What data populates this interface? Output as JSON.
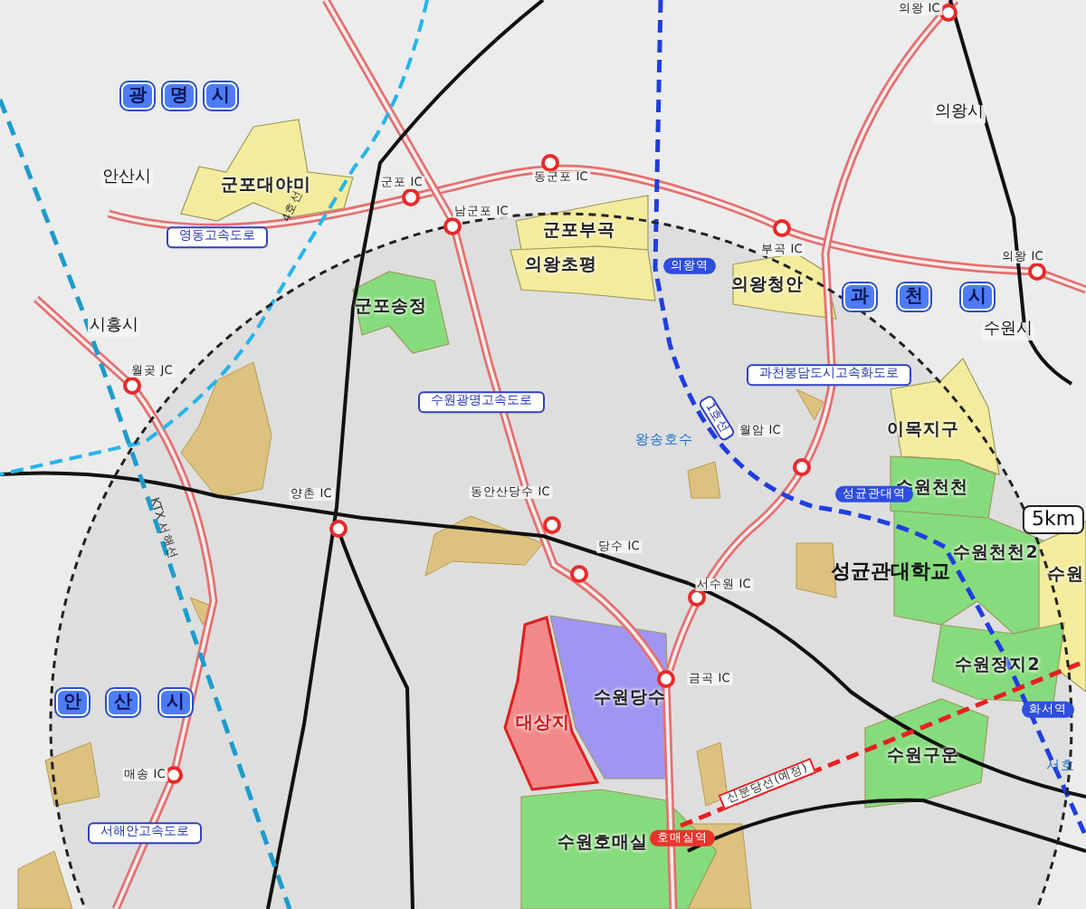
{
  "map": {
    "city_names": [
      "안산시",
      "의왕시",
      "시흥시",
      "수원시"
    ],
    "boxed_city_names": [
      {
        "chars": [
          "광",
          "명",
          "시"
        ]
      },
      {
        "chars": [
          "과",
          "천",
          "시"
        ]
      },
      {
        "chars": [
          "안",
          "산",
          "시"
        ]
      }
    ],
    "zones": [
      {
        "label": "군포대야미",
        "color": "#f4ec9c",
        "kind": "zone"
      },
      {
        "label": "군포부곡",
        "color": "#f4ec9c",
        "kind": "zone"
      },
      {
        "label": "의왕초평",
        "color": "#f4ec9c",
        "kind": "zone"
      },
      {
        "label": "의왕청안",
        "color": "#f4ec9c",
        "kind": "zone"
      },
      {
        "label": "군포송정",
        "color": "#86dc7c",
        "kind": "zone"
      },
      {
        "label": "이목지구",
        "color": "#f4ec9c",
        "kind": "zone"
      },
      {
        "label": "수원천천",
        "color": "#86dc7c",
        "kind": "zone"
      },
      {
        "label": "수원천천2",
        "color": "#86dc7c",
        "kind": "zone"
      },
      {
        "label": "수원",
        "color": "#f4ec9c",
        "kind": "zone"
      },
      {
        "label": "수원정지2",
        "color": "#86dc7c",
        "kind": "zone"
      },
      {
        "label": "수원당수",
        "color": "#a096f2",
        "kind": "zone"
      },
      {
        "label": "대상지",
        "color": "#f28a8a",
        "kind": "target"
      },
      {
        "label": "수원구운",
        "color": "#86dc7c",
        "kind": "zone"
      },
      {
        "label": "수원호매실",
        "color": "#86dc7c",
        "kind": "zone"
      }
    ],
    "interchanges": [
      "의왕 IC",
      "군포 IC",
      "남군포 IC",
      "동군포 IC",
      "부곡 IC",
      "의왕 IC",
      "월곶 JC",
      "양촌 IC",
      "동안산당수 IC",
      "월암 IC",
      "당수 IC",
      "서수원 IC",
      "금곡 IC",
      "매송 IC"
    ],
    "road_names": [
      "영동고속도로",
      "수원광명고속도로",
      "과천봉담도시고속화도로",
      "서해안고속도로"
    ],
    "rail_lines": [
      {
        "label": "4호선",
        "kind": "plain"
      },
      {
        "label": "KTX 서해선",
        "kind": "plain"
      },
      {
        "label": "1호선",
        "kind": "boxed"
      },
      {
        "label": "신분당선(예정)",
        "kind": "planned"
      }
    ],
    "stations": [
      {
        "label": "의왕역",
        "color": "#2f4ee0"
      },
      {
        "label": "성균관대역",
        "color": "#2f4ee0"
      },
      {
        "label": "호매실역",
        "color": "#e8352c"
      },
      {
        "label": "화서역",
        "color": "#2f4ee0"
      }
    ],
    "places": [
      {
        "label": "왕송호수",
        "kind": "water"
      },
      {
        "label": "서호",
        "kind": "water"
      },
      {
        "label": "성균관대학교",
        "kind": "landmark"
      }
    ],
    "radius_label": "5km"
  }
}
